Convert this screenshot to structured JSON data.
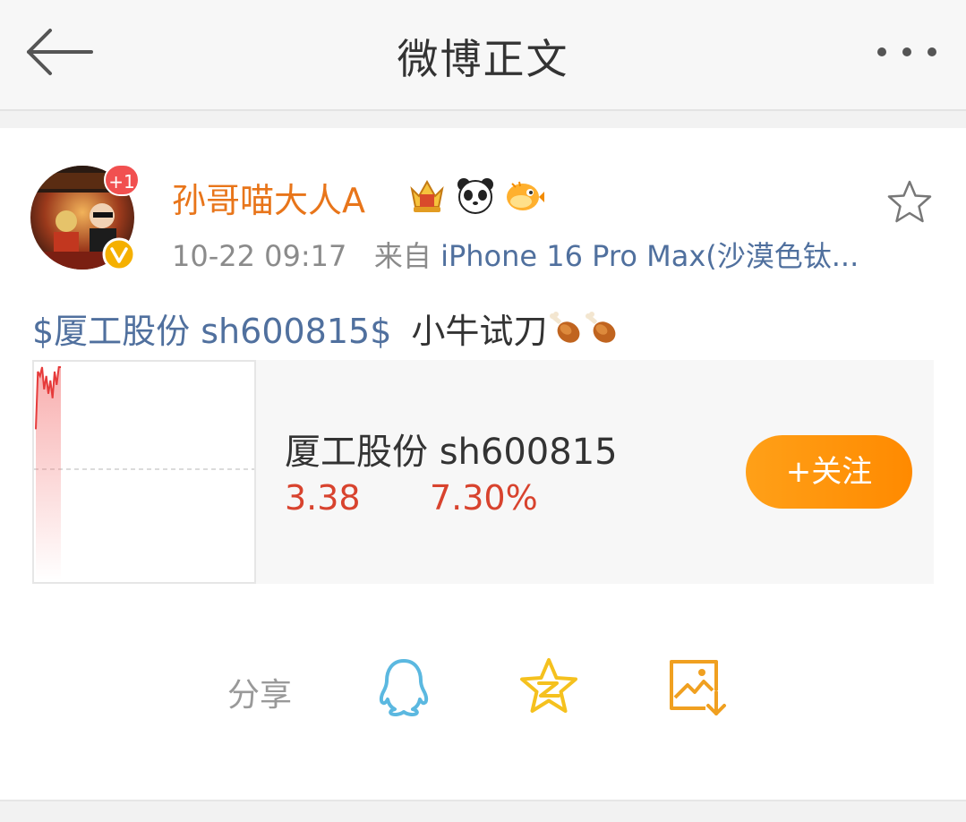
{
  "nav": {
    "title": "微博正文",
    "back_icon": "arrow-left-icon",
    "more_icon": "more-dots-icon"
  },
  "post": {
    "author": {
      "name": "孙哥喵大人A",
      "badge_count": "+1",
      "verified_icon": "verified-v-icon",
      "name_icons": [
        "crown-medal-icon",
        "panda-icon",
        "puffer-fish-icon"
      ]
    },
    "time": "10-22 09:17",
    "source_prefix": "来自",
    "source": "iPhone 16 Pro Max(沙漠色钛...",
    "text": {
      "tag": "$厦工股份 sh600815$",
      "body": "小牛试刀",
      "emoji": [
        "drumstick-icon",
        "drumstick-icon"
      ]
    }
  },
  "stock": {
    "name": "厦工股份 sh600815",
    "price": "3.38",
    "change": "7.30%",
    "follow_label": "+关注",
    "chart_data": {
      "type": "line",
      "x": [
        0,
        1,
        2,
        3,
        4,
        5,
        6,
        7,
        8,
        9,
        10,
        11,
        12
      ],
      "values": [
        3.24,
        3.37,
        3.36,
        3.38,
        3.33,
        3.36,
        3.32,
        3.35,
        3.31,
        3.37,
        3.34,
        3.38,
        3.38
      ],
      "baseline": 3.15
    }
  },
  "share": {
    "label": "分享",
    "targets": [
      "qq-icon",
      "qzone-star-icon",
      "save-image-icon"
    ]
  },
  "colors": {
    "username": "#e8751a",
    "link": "#50709e",
    "stock_red": "#d8432e",
    "follow_orange": "#ff9500"
  }
}
